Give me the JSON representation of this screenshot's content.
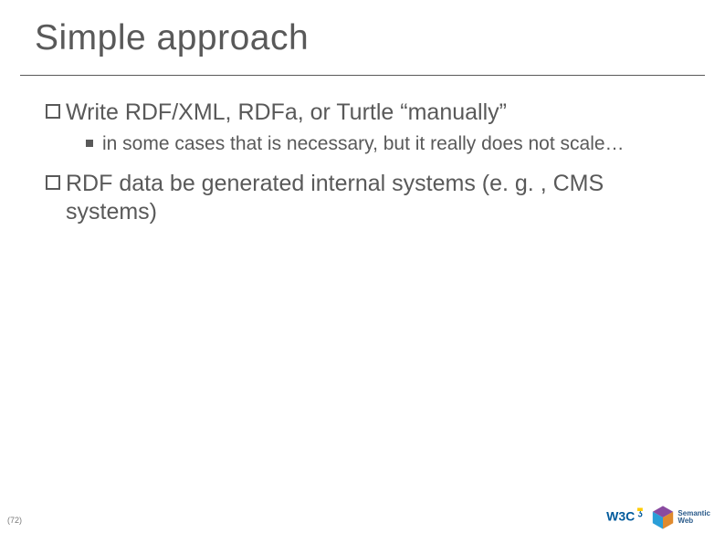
{
  "title": "Simple approach",
  "bullets": [
    {
      "level": 1,
      "text": "Write RDF/XML, RDFa, or Turtle “manually”"
    },
    {
      "level": 2,
      "text": "in some cases that is necessary, but it really does not scale…"
    },
    {
      "level": 1,
      "text": "RDF data be generated internal systems (e. g. , CMS systems)"
    }
  ],
  "page_number": "(72)",
  "logos": {
    "w3c_label": "W3C",
    "sw_line1": "Semantic",
    "sw_line2": "Web"
  }
}
